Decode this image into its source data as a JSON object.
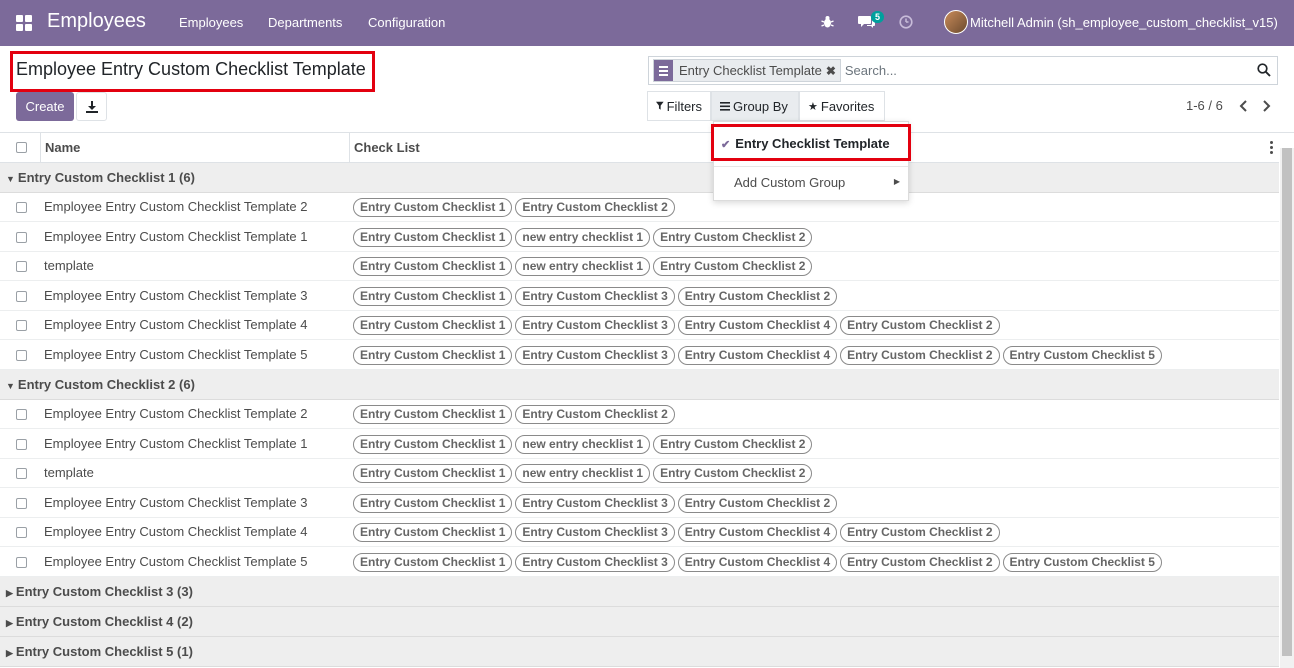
{
  "navbar": {
    "app_title": "Employees",
    "menu": [
      "Employees",
      "Departments",
      "Configuration"
    ],
    "message_count": "5",
    "user": "Mitchell Admin (sh_employee_custom_checklist_v15)"
  },
  "control": {
    "title": "Employee Entry Custom Checklist Template",
    "create_label": "Create",
    "search": {
      "facet": "Entry Checklist Template",
      "placeholder": "Search..."
    },
    "filters_label": "Filters",
    "groupby_label": "Group By",
    "favorites_label": "Favorites",
    "pager": "1-6 / 6"
  },
  "dropdown": {
    "selected": "Entry Checklist Template",
    "add_custom": "Add Custom Group"
  },
  "table": {
    "headers": {
      "name": "Name",
      "check_list": "Check List"
    },
    "groups": [
      {
        "label": "Entry Custom Checklist 1 (6)",
        "expanded": true,
        "rows": [
          {
            "name": "Employee Entry Custom Checklist Template 2",
            "tags": [
              "Entry Custom Checklist 1",
              "Entry Custom Checklist 2"
            ]
          },
          {
            "name": "Employee Entry Custom Checklist Template 1",
            "tags": [
              "Entry Custom Checklist 1",
              "new entry checklist 1",
              "Entry Custom Checklist 2"
            ]
          },
          {
            "name": "template",
            "tags": [
              "Entry Custom Checklist 1",
              "new entry checklist 1",
              "Entry Custom Checklist 2"
            ]
          },
          {
            "name": "Employee Entry Custom Checklist Template 3",
            "tags": [
              "Entry Custom Checklist 1",
              "Entry Custom Checklist 3",
              "Entry Custom Checklist 2"
            ]
          },
          {
            "name": "Employee Entry Custom Checklist Template 4",
            "tags": [
              "Entry Custom Checklist 1",
              "Entry Custom Checklist 3",
              "Entry Custom Checklist 4",
              "Entry Custom Checklist 2"
            ]
          },
          {
            "name": "Employee Entry Custom Checklist Template 5",
            "tags": [
              "Entry Custom Checklist 1",
              "Entry Custom Checklist 3",
              "Entry Custom Checklist 4",
              "Entry Custom Checklist 2",
              "Entry Custom Checklist 5"
            ]
          }
        ]
      },
      {
        "label": "Entry Custom Checklist 2 (6)",
        "expanded": true,
        "rows": [
          {
            "name": "Employee Entry Custom Checklist Template 2",
            "tags": [
              "Entry Custom Checklist 1",
              "Entry Custom Checklist 2"
            ]
          },
          {
            "name": "Employee Entry Custom Checklist Template 1",
            "tags": [
              "Entry Custom Checklist 1",
              "new entry checklist 1",
              "Entry Custom Checklist 2"
            ]
          },
          {
            "name": "template",
            "tags": [
              "Entry Custom Checklist 1",
              "new entry checklist 1",
              "Entry Custom Checklist 2"
            ]
          },
          {
            "name": "Employee Entry Custom Checklist Template 3",
            "tags": [
              "Entry Custom Checklist 1",
              "Entry Custom Checklist 3",
              "Entry Custom Checklist 2"
            ]
          },
          {
            "name": "Employee Entry Custom Checklist Template 4",
            "tags": [
              "Entry Custom Checklist 1",
              "Entry Custom Checklist 3",
              "Entry Custom Checklist 4",
              "Entry Custom Checklist 2"
            ]
          },
          {
            "name": "Employee Entry Custom Checklist Template 5",
            "tags": [
              "Entry Custom Checklist 1",
              "Entry Custom Checklist 3",
              "Entry Custom Checklist 4",
              "Entry Custom Checklist 2",
              "Entry Custom Checklist 5"
            ]
          }
        ]
      },
      {
        "label": "Entry Custom Checklist 3 (3)",
        "expanded": false,
        "rows": []
      },
      {
        "label": "Entry Custom Checklist 4 (2)",
        "expanded": false,
        "rows": []
      },
      {
        "label": "Entry Custom Checklist 5 (1)",
        "expanded": false,
        "rows": []
      }
    ]
  }
}
